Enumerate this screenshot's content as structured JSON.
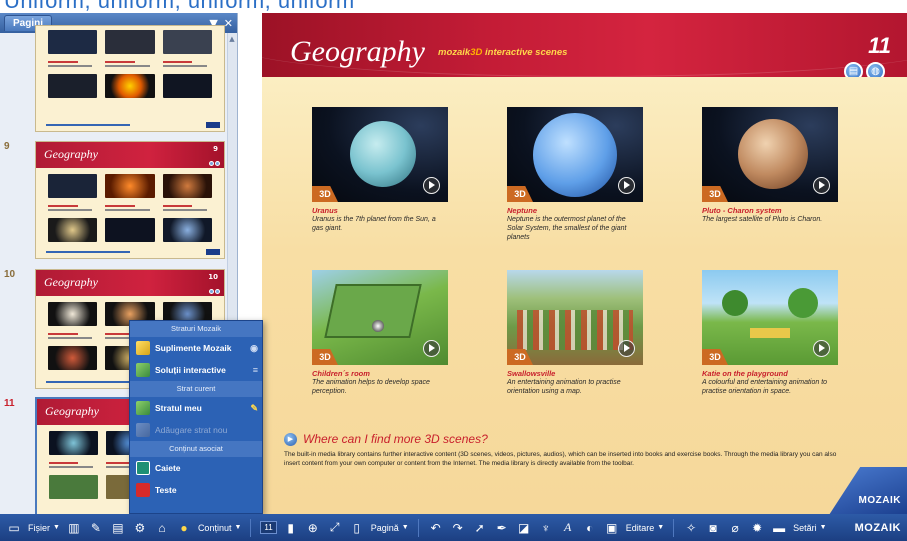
{
  "top_strip": {
    "text": "Uniform, uniform, uniform, uniform"
  },
  "sidebar": {
    "tab_label": "Pagini",
    "collapse_glyph": "▼",
    "close_glyph": "✕",
    "pages": [
      {
        "num": "",
        "title": "",
        "page_no": ""
      },
      {
        "num": "9",
        "title": "Geography",
        "page_no": "9"
      },
      {
        "num": "10",
        "title": "Geography",
        "page_no": "10"
      },
      {
        "num": "11",
        "title": "Geography",
        "page_no": "11"
      }
    ]
  },
  "page": {
    "title": "Geography",
    "subtitle_brand": "mozaik",
    "subtitle_3d": "3D",
    "subtitle_rest": " interactive scenes",
    "number": "11",
    "cards": [
      {
        "badge": "3D",
        "title": "Uranus",
        "desc": "Uranus is the 7th planet from the Sun, a gas giant."
      },
      {
        "badge": "3D",
        "title": "Neptune",
        "desc": "Neptune is the outermost planet of the Solar System, the smallest of the giant planets"
      },
      {
        "badge": "3D",
        "title": "Pluto - Charon system",
        "desc": "The largest satellite of Pluto is Charon."
      },
      {
        "badge": "3D",
        "title": "Children´s room",
        "desc": "The animation helps to develop space perception."
      },
      {
        "badge": "3D",
        "title": "Swallowsville",
        "desc": "An entertaining animation to practise orientation using a map."
      },
      {
        "badge": "3D",
        "title": "Katie on the playground",
        "desc": "A colourful and entertaining animation to practise orientation in space."
      }
    ],
    "more_title": "Where can I find more 3D scenes?",
    "more_text": "The built-in media library contains further interactive content (3D scenes, videos, pictures, audios), which can be inserted into books and exercise books. Through the media library you can also insert content from your own computer or content from the Internet. The media library is directly available from the toolbar.",
    "corner_brand": "MOZAIK"
  },
  "layer_menu": {
    "section1": "Straturi Mozaik",
    "item_suplimente": "Suplimente Mozaik",
    "item_solutii": "Soluții interactive",
    "section2": "Strat curent",
    "item_stratul": "Stratul meu",
    "item_adaugare": "Adăugare strat nou",
    "section3": "Conținut asociat",
    "item_caiete": "Caiete",
    "item_teste": "Teste"
  },
  "toolbar": {
    "file_label": "Fișier",
    "content_label": "Conținut",
    "page_num": "11",
    "page_label": "Pagină",
    "edit_label": "Editare",
    "settings_label": "Setări",
    "brand": "MOZAIK"
  },
  "colors": {
    "accent": "#2c62b5",
    "header_red": "#c31c36",
    "title_red": "#c8202c"
  }
}
